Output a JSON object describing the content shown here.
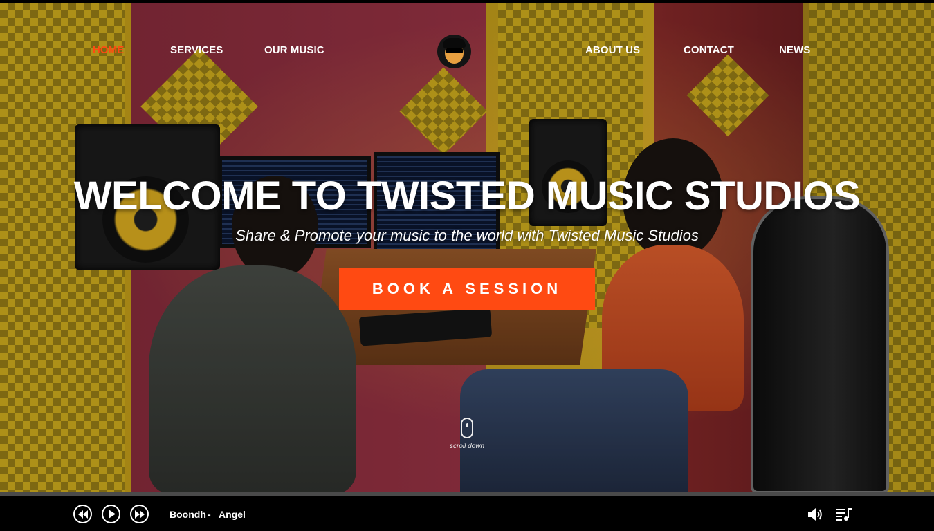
{
  "nav": {
    "home": "HOME",
    "services": "SERVICES",
    "our_music": "OUR MUSIC",
    "about_us": "ABOUT US",
    "contact": "CONTACT",
    "news": "NEWS",
    "logo_icon": "studio-logo-icon"
  },
  "hero": {
    "title": "WELCOME TO TWISTED MUSIC STUDIOS",
    "subtitle": "Share & Promote your music to the world with Twisted Music Studios",
    "cta_label": "BOOK A SESSION",
    "scroll_label": "scroll down"
  },
  "player": {
    "artist": "Boondh",
    "separator": "-",
    "song": "Angel",
    "controls": [
      "rewind-icon",
      "play-icon",
      "fast-forward-icon"
    ],
    "volume_icon": "volume-icon",
    "playlist_icon": "playlist-icon",
    "progress": 0
  },
  "colors": {
    "accent": "#ff4a12",
    "nav_text": "#ffffff",
    "player_bg": "#000000"
  }
}
